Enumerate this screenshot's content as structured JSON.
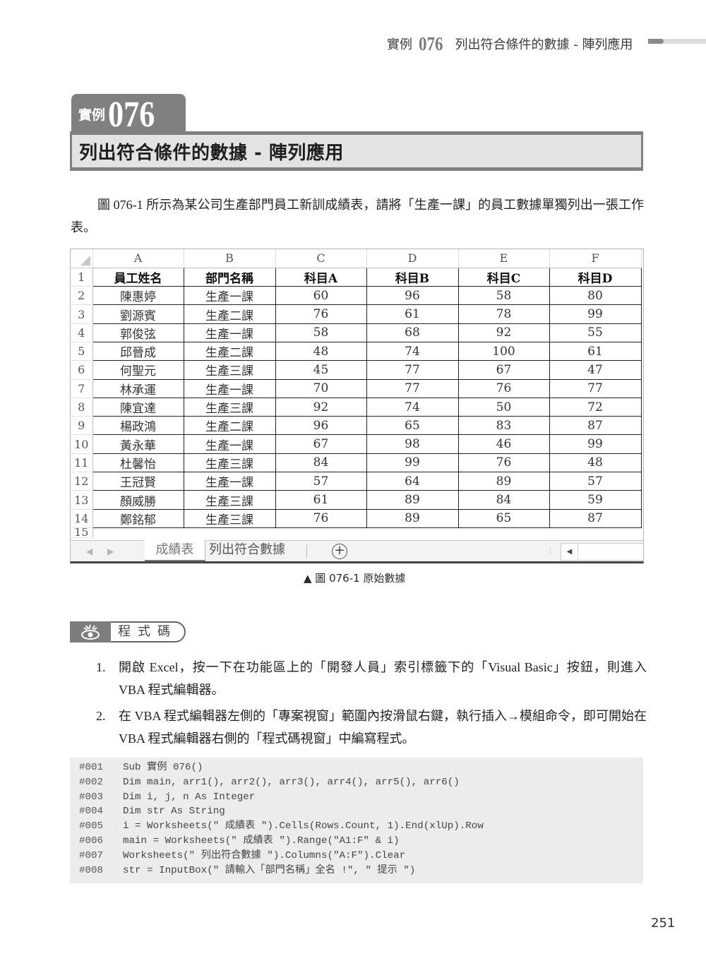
{
  "running_header": {
    "prefix": "實例",
    "number": "076",
    "title": "列出符合條件的數據 - 陣列應用"
  },
  "chapter": {
    "prefix": "實例",
    "number": "076",
    "title": "列出符合條件的數據 - 陣列應用"
  },
  "intro": "圖 076-1 所示為某公司生產部門員工新訓成績表，請將「生產一課」的員工數據單獨列出一張工作表。",
  "spreadsheet": {
    "column_headers": [
      "A",
      "B",
      "C",
      "D",
      "E",
      "F"
    ],
    "row_numbers": [
      "1",
      "2",
      "3",
      "4",
      "5",
      "6",
      "7",
      "8",
      "9",
      "10",
      "11",
      "12",
      "13",
      "14",
      "15"
    ],
    "header_row": [
      "員工姓名",
      "部門名稱",
      "科目A",
      "科目B",
      "科目C",
      "科目D"
    ],
    "rows": [
      [
        "陳惠婷",
        "生產一課",
        "60",
        "96",
        "58",
        "80"
      ],
      [
        "劉源賓",
        "生產二課",
        "76",
        "61",
        "78",
        "99"
      ],
      [
        "郭俊弦",
        "生產一課",
        "58",
        "68",
        "92",
        "55"
      ],
      [
        "邱晉成",
        "生產二課",
        "48",
        "74",
        "100",
        "61"
      ],
      [
        "何聖元",
        "生產三課",
        "45",
        "77",
        "67",
        "47"
      ],
      [
        "林承運",
        "生產一課",
        "70",
        "77",
        "76",
        "77"
      ],
      [
        "陳宜達",
        "生產三課",
        "92",
        "74",
        "50",
        "72"
      ],
      [
        "楊政鴻",
        "生產二課",
        "96",
        "65",
        "83",
        "87"
      ],
      [
        "黃永華",
        "生產一課",
        "67",
        "98",
        "46",
        "99"
      ],
      [
        "杜馨怡",
        "生產三課",
        "84",
        "99",
        "76",
        "48"
      ],
      [
        "王冠賢",
        "生產一課",
        "57",
        "64",
        "89",
        "57"
      ],
      [
        "顏威勝",
        "生產三課",
        "61",
        "89",
        "84",
        "59"
      ],
      [
        "鄭銘郁",
        "生產三課",
        "76",
        "89",
        "65",
        "87"
      ]
    ],
    "sheet_tabs": [
      {
        "label": "成績表",
        "active": true
      },
      {
        "label": "列出符合數據",
        "active": false
      }
    ],
    "add_sheet_icon": "plus-circle-icon",
    "nav_icons": [
      "triangle-left-icon",
      "triangle-right-icon"
    ]
  },
  "figure_caption": "▲ 圖 076-1 原始數據",
  "code_section_label": "程式碼",
  "code_section_icon": "eye-icon",
  "steps": [
    {
      "num": "1.",
      "text": "開啟 Excel，按一下在功能區上的「開發人員」索引標籤下的「Visual Basic」按鈕，則進入 VBA 程式編輯器。"
    },
    {
      "num": "2.",
      "text": "在 VBA 程式編輯器左側的「專案視窗」範圍內按滑鼠右鍵，執行插入→模組命令，即可開始在 VBA 程式編輯器右側的「程式碼視窗」中編寫程式。"
    }
  ],
  "code_lines": [
    {
      "ln": "#001",
      "code": "Sub 實例 076()"
    },
    {
      "ln": "#002",
      "code": "Dim main, arr1(), arr2(), arr3(), arr4(), arr5(), arr6()"
    },
    {
      "ln": "#003",
      "code": "Dim i, j, n As Integer"
    },
    {
      "ln": "#004",
      "code": "Dim str As String"
    },
    {
      "ln": "#005",
      "code": "i = Worksheets(\" 成績表 \").Cells(Rows.Count, 1).End(xlUp).Row"
    },
    {
      "ln": "#006",
      "code": "main = Worksheets(\" 成績表 \").Range(\"A1:F\" & i)"
    },
    {
      "ln": "#007",
      "code": "Worksheets(\" 列出符合數據 \").Columns(\"A:F\").Clear"
    },
    {
      "ln": "#008",
      "code": "str = InputBox(\" 請輸入「部門名稱」全名 !\", \" 提示 \")"
    }
  ],
  "page_number": "251"
}
